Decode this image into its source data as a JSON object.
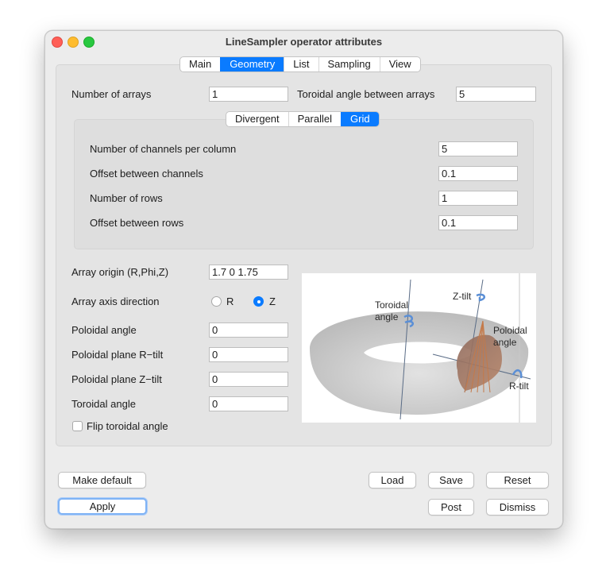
{
  "window": {
    "title": "LineSampler operator attributes"
  },
  "main_tabs": [
    {
      "label": "Main",
      "selected": false
    },
    {
      "label": "Geometry",
      "selected": true
    },
    {
      "label": "List",
      "selected": false
    },
    {
      "label": "Sampling",
      "selected": false
    },
    {
      "label": "View",
      "selected": false
    }
  ],
  "geometry": {
    "num_arrays_label": "Number of arrays",
    "num_arrays_value": "1",
    "toroidal_between_label": "Toroidal angle between arrays",
    "toroidal_between_value": "5",
    "sub_tabs": [
      {
        "label": "Divergent",
        "selected": false
      },
      {
        "label": "Parallel",
        "selected": false
      },
      {
        "label": "Grid",
        "selected": true
      }
    ],
    "grid": {
      "channels_per_column_label": "Number of channels per column",
      "channels_per_column_value": "5",
      "offset_channels_label": "Offset between channels",
      "offset_channels_value": "0.1",
      "num_rows_label": "Number of rows",
      "num_rows_value": "1",
      "offset_rows_label": "Offset between rows",
      "offset_rows_value": "0.1"
    },
    "array_origin_label": "Array origin (R,Phi,Z)",
    "array_origin_value": "1.7 0 1.75",
    "axis_direction_label": "Array axis direction",
    "axis_r_label": "R",
    "axis_z_label": "Z",
    "axis_selected": "Z",
    "poloidal_angle_label": "Poloidal angle",
    "poloidal_angle_value": "0",
    "r_tilt_label": "Poloidal plane R−tilt",
    "r_tilt_value": "0",
    "z_tilt_label": "Poloidal plane Z−tilt",
    "z_tilt_value": "0",
    "toroidal_angle_label": "Toroidal angle",
    "toroidal_angle_value": "0",
    "flip_label": "Flip toroidal angle",
    "flip_checked": false,
    "diagram": {
      "toroidal_line1": "Toroidal",
      "toroidal_line2": "angle",
      "ztilt": "Z-tilt",
      "poloidal_line1": "Poloidal",
      "poloidal_line2": "angle",
      "rtilt": "R-tilt"
    }
  },
  "buttons": {
    "make_default": "Make default",
    "load": "Load",
    "save": "Save",
    "reset": "Reset",
    "apply": "Apply",
    "post": "Post",
    "dismiss": "Dismiss"
  },
  "colors": {
    "accent": "#0a7bff",
    "torus": "#cfcfcf",
    "sampler": "#c47a4a"
  }
}
